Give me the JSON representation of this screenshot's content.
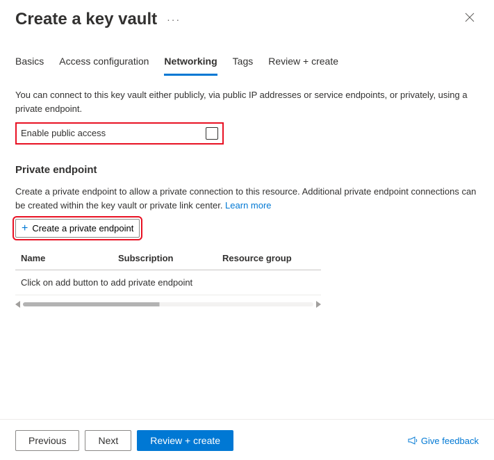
{
  "header": {
    "title": "Create a key vault",
    "ellipsis": "···"
  },
  "tabs": {
    "items": [
      {
        "label": "Basics",
        "active": false
      },
      {
        "label": "Access configuration",
        "active": false
      },
      {
        "label": "Networking",
        "active": true
      },
      {
        "label": "Tags",
        "active": false
      },
      {
        "label": "Review + create",
        "active": false
      }
    ]
  },
  "networking": {
    "description": "You can connect to this key vault either publicly, via public IP addresses or service endpoints, or privately, using a private endpoint.",
    "enable_public_access_label": "Enable public access",
    "enable_public_access_checked": false
  },
  "private_endpoint": {
    "title": "Private endpoint",
    "description_pre": "Create a private endpoint to allow a private connection to this resource. Additional private endpoint connections can be created within the key vault or private link center.  ",
    "learn_more": "Learn more",
    "create_button": "Create a private endpoint",
    "columns": {
      "name": "Name",
      "subscription": "Subscription",
      "resource_group": "Resource group"
    },
    "empty_message": "Click on add button to add private endpoint"
  },
  "footer": {
    "previous": "Previous",
    "next": "Next",
    "review_create": "Review + create",
    "feedback": "Give feedback"
  }
}
